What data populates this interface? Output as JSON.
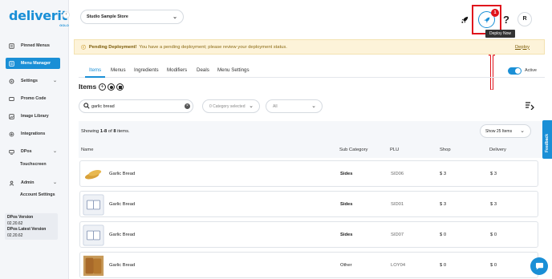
{
  "brand": {
    "name": "deliverit",
    "sub": "GOLO"
  },
  "sidebar": {
    "items": [
      {
        "label": "Pinned Menus",
        "icon": "pin-icon"
      },
      {
        "label": "Menu Manager",
        "icon": "menu-icon",
        "active": true
      },
      {
        "label": "Settings",
        "icon": "gear-icon"
      },
      {
        "label": "Promo Code",
        "icon": "tag-icon"
      },
      {
        "label": "Image Library",
        "icon": "image-icon"
      },
      {
        "label": "Integrations",
        "icon": "plug-icon"
      },
      {
        "label": "DPos",
        "icon": "pos-icon"
      },
      {
        "label": "Admin",
        "icon": "admin-icon"
      }
    ],
    "sub": {
      "touchscreen": "Touchscreen",
      "account_settings": "Account Settings"
    },
    "version": {
      "label1": "DPos Version",
      "value1": "02.20.62",
      "label2": "DPos Latest Version",
      "value2": "02.20.62"
    }
  },
  "header": {
    "store": "Studio Sample Store",
    "notif_count": "1",
    "tooltip": "Deploy Now",
    "avatar": "R",
    "help": "?"
  },
  "banner": {
    "title": "Pending Deployment!",
    "message": "You have a pending deployment; please review your deployment status.",
    "link": "Deploy"
  },
  "tabs": [
    "Items",
    "Menus",
    "Ingredients",
    "Modifiers",
    "Deals",
    "Menu Settings"
  ],
  "toggle_label": "Active",
  "items_title": "Items",
  "filters": {
    "search_value": "garlic bread",
    "category": "0 Category selected",
    "status": "All"
  },
  "table": {
    "showing_prefix": "Showing ",
    "showing_range": "1-8",
    "showing_mid": " of ",
    "showing_total": "8",
    "showing_suffix": " items.",
    "page_size": "Show 25 Items",
    "columns": [
      "Name",
      "Sub Category",
      "PLU",
      "Shop",
      "Delivery"
    ],
    "rows": [
      {
        "name": "Garlic Bread",
        "cat": "Sides",
        "plu": "SID06",
        "shop": "$ 3",
        "del": "$ 3",
        "thumb": "bread"
      },
      {
        "name": "Garlic Bread",
        "cat": "Sides",
        "plu": "SID01",
        "shop": "$ 3",
        "del": "$ 3",
        "thumb": "placeholder"
      },
      {
        "name": "Garlic Bread",
        "cat": "Sides",
        "plu": "SID07",
        "shop": "$ 0",
        "del": "$ 0",
        "thumb": "placeholder"
      },
      {
        "name": "Garlic Bread",
        "cat": "Other",
        "plu": "LOY04",
        "shop": "$ 0",
        "del": "$ 0",
        "thumb": "toast"
      }
    ]
  },
  "feedback": "Feedback",
  "colors": {
    "accent": "#1a8fd6",
    "alert": "#e0141c",
    "banner": "#fdf3d9"
  }
}
